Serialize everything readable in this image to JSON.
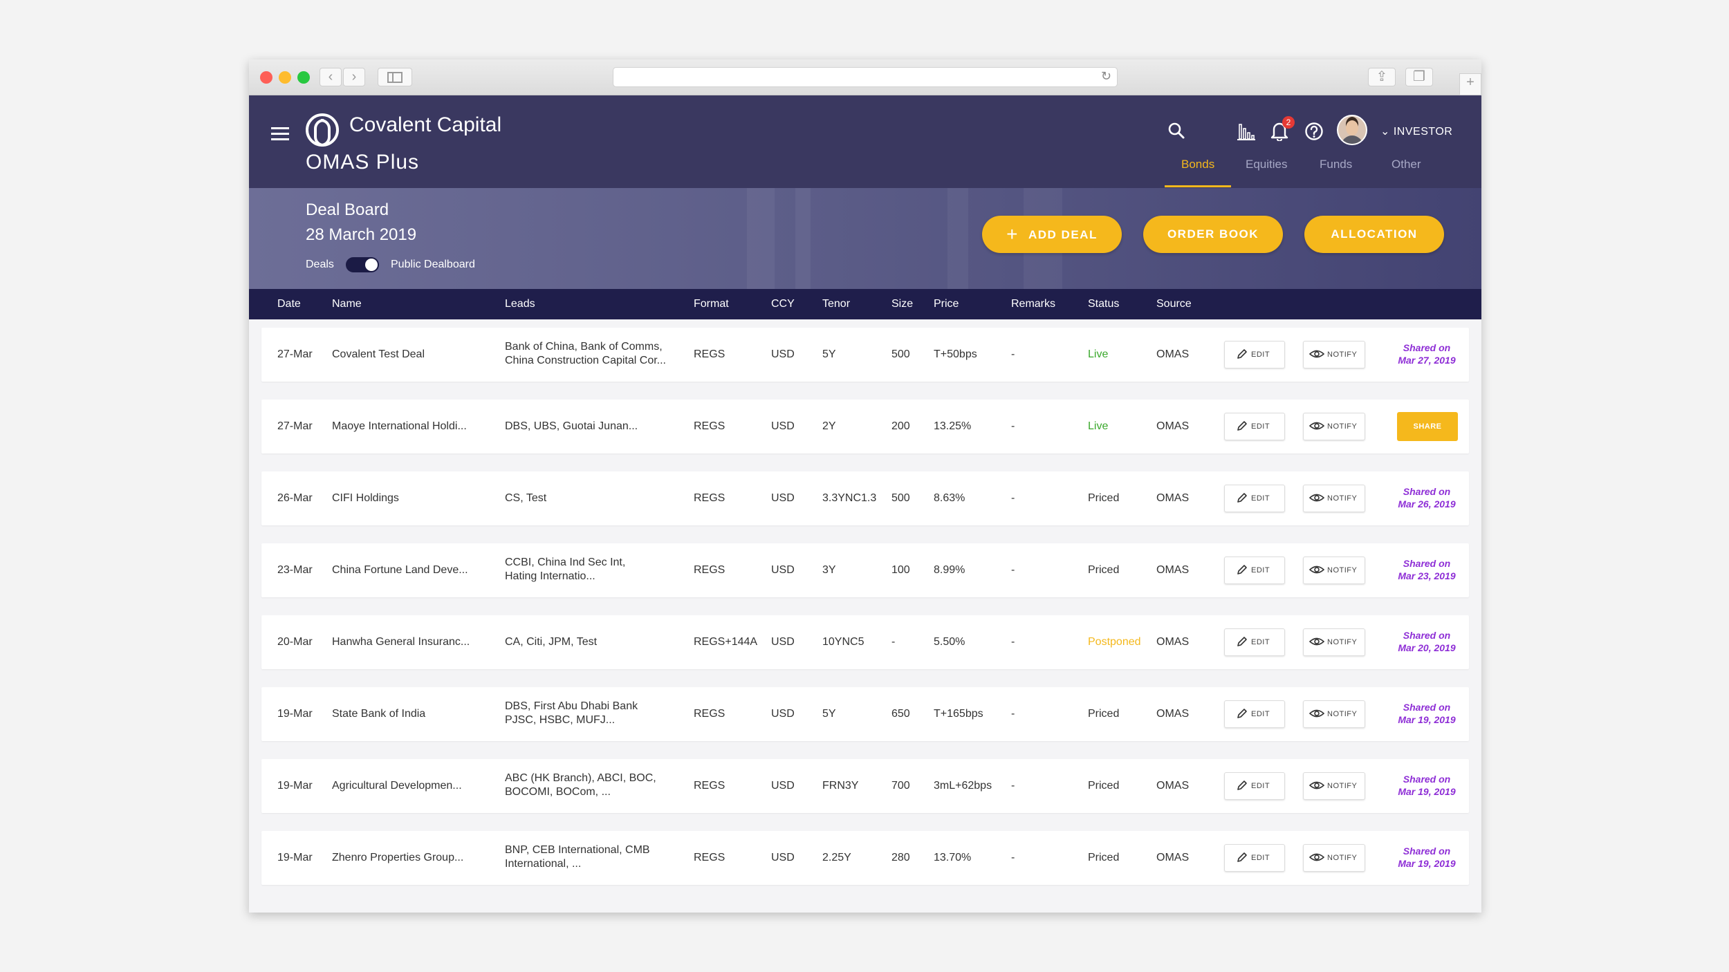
{
  "app": {
    "brand": "Covalent Capital",
    "product": "OMAS Plus",
    "notifications_count": "2",
    "role": "INVESTOR",
    "tabs": [
      {
        "label": "Bonds",
        "active": true
      },
      {
        "label": "Equities",
        "active": false
      },
      {
        "label": "Funds",
        "active": false
      },
      {
        "label": "Other",
        "active": false
      }
    ]
  },
  "board": {
    "title": "Deal Board",
    "date": "28 March 2019",
    "toggle_left": "Deals",
    "toggle_right": "Public Dealboard",
    "add_deal_label": "ADD DEAL",
    "order_book_label": "ORDER BOOK",
    "allocation_label": "ALLOCATION"
  },
  "table": {
    "columns": [
      "Date",
      "Name",
      "Leads",
      "Format",
      "CCY",
      "Tenor",
      "Size",
      "Price",
      "Remarks",
      "Status",
      "Source"
    ],
    "edit_label": "EDIT",
    "notify_label": "NOTIFY",
    "share_label": "SHARE",
    "rows": [
      {
        "date": "27-Mar",
        "name": "Covalent Test Deal",
        "leads1": "Bank of China, Bank of Comms,",
        "leads2": "China Construction Capital Cor...",
        "format": "REGS",
        "ccy": "USD",
        "tenor": "5Y",
        "size": "500",
        "price": "T+50bps",
        "remarks": "-",
        "status": "Live",
        "status_type": "live",
        "source": "OMAS",
        "shared1": "Shared on",
        "shared2": "Mar 27, 2019"
      },
      {
        "date": "27-Mar",
        "name": "Maoye International Holdi...",
        "leads1": "DBS, UBS, Guotai Junan...",
        "leads2": "",
        "format": "REGS",
        "ccy": "USD",
        "tenor": "2Y",
        "size": "200",
        "price": "13.25%",
        "remarks": "-",
        "status": "Live",
        "status_type": "live",
        "source": "OMAS",
        "shared1": "",
        "shared2": ""
      },
      {
        "date": "26-Mar",
        "name": "CIFI Holdings",
        "leads1": "CS, Test",
        "leads2": "",
        "format": "REGS",
        "ccy": "USD",
        "tenor": "3.3YNC1.3",
        "size": "500",
        "price": "8.63%",
        "remarks": "-",
        "status": "Priced",
        "status_type": "priced",
        "source": "OMAS",
        "shared1": "Shared on",
        "shared2": "Mar 26, 2019"
      },
      {
        "date": "23-Mar",
        "name": "China Fortune Land Deve...",
        "leads1": "CCBI, China Ind Sec Int,",
        "leads2": "Hating Internatio...",
        "format": "REGS",
        "ccy": "USD",
        "tenor": "3Y",
        "size": "100",
        "price": "8.99%",
        "remarks": "-",
        "status": "Priced",
        "status_type": "priced",
        "source": "OMAS",
        "shared1": "Shared on",
        "shared2": "Mar 23, 2019"
      },
      {
        "date": "20-Mar",
        "name": "Hanwha General Insuranc...",
        "leads1": "CA, Citi, JPM, Test",
        "leads2": "",
        "format": "REGS+144A",
        "ccy": "USD",
        "tenor": "10YNC5",
        "size": "-",
        "price": "5.50%",
        "remarks": "-",
        "status": "Postponed",
        "status_type": "postponed",
        "source": "OMAS",
        "shared1": "Shared on",
        "shared2": "Mar 20, 2019"
      },
      {
        "date": "19-Mar",
        "name": "State Bank of India",
        "leads1": "DBS, First Abu Dhabi Bank",
        "leads2": "PJSC, HSBC, MUFJ...",
        "format": "REGS",
        "ccy": "USD",
        "tenor": "5Y",
        "size": "650",
        "price": "T+165bps",
        "remarks": "-",
        "status": "Priced",
        "status_type": "priced",
        "source": "OMAS",
        "shared1": "Shared on",
        "shared2": "Mar 19, 2019"
      },
      {
        "date": "19-Mar",
        "name": "Agricultural Developmen...",
        "leads1": "ABC (HK Branch), ABCI, BOC,",
        "leads2": "BOCOMI, BOCom, ...",
        "format": "REGS",
        "ccy": "USD",
        "tenor": "FRN3Y",
        "size": "700",
        "price": "3mL+62bps",
        "remarks": "-",
        "status": "Priced",
        "status_type": "priced",
        "source": "OMAS",
        "shared1": "Shared on",
        "shared2": "Mar 19, 2019"
      },
      {
        "date": "19-Mar",
        "name": "Zhenro Properties Group...",
        "leads1": "BNP, CEB International, CMB",
        "leads2": "International, ...",
        "format": "REGS",
        "ccy": "USD",
        "tenor": "2.25Y",
        "size": "280",
        "price": "13.70%",
        "remarks": "-",
        "status": "Priced",
        "status_type": "priced",
        "source": "OMAS",
        "shared1": "Shared on",
        "shared2": "Mar 19, 2019"
      }
    ]
  }
}
